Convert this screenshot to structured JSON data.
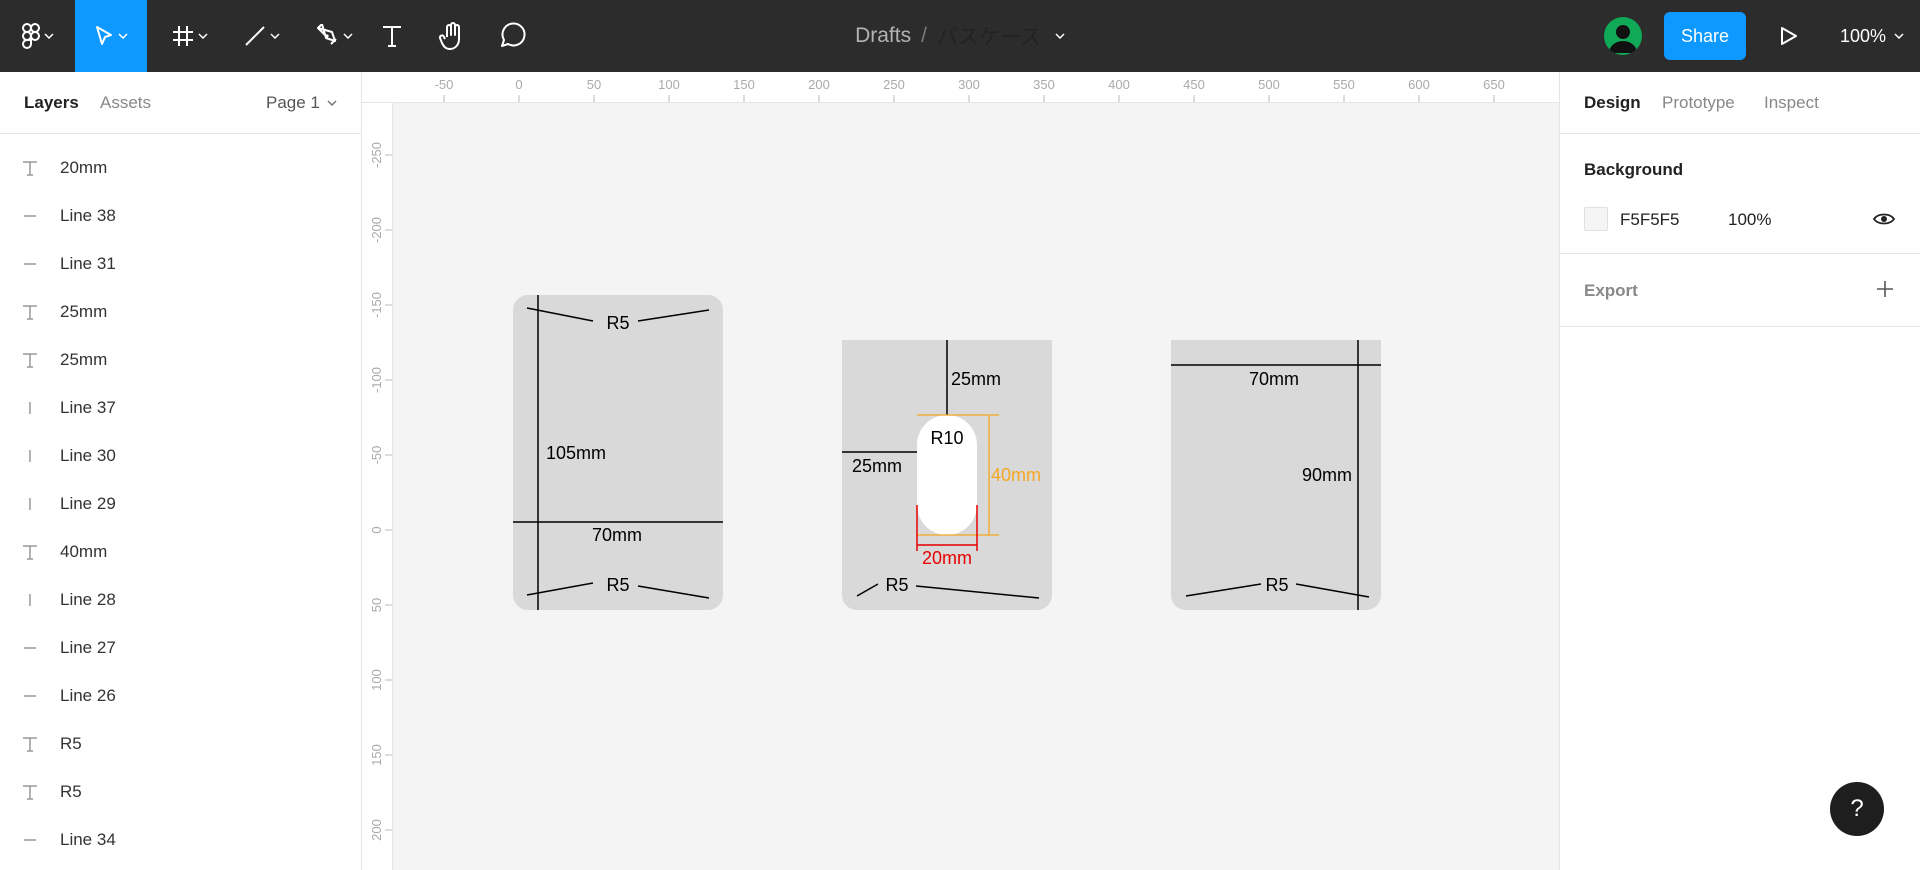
{
  "toolbar": {
    "breadcrumb_drafts": "Drafts",
    "breadcrumb_sep": "/",
    "file_name": "パスケース",
    "share_label": "Share",
    "zoom_label": "100%"
  },
  "left_panel": {
    "tab_layers": "Layers",
    "tab_assets": "Assets",
    "page_selector": "Page 1",
    "layers": [
      {
        "name": "20mm",
        "type": "text"
      },
      {
        "name": "Line 38",
        "type": "hline"
      },
      {
        "name": "Line 31",
        "type": "hline"
      },
      {
        "name": "25mm",
        "type": "text"
      },
      {
        "name": "25mm",
        "type": "text"
      },
      {
        "name": "Line 37",
        "type": "vline"
      },
      {
        "name": "Line 30",
        "type": "vline"
      },
      {
        "name": "Line 29",
        "type": "vline"
      },
      {
        "name": "40mm",
        "type": "text"
      },
      {
        "name": "Line 28",
        "type": "vline"
      },
      {
        "name": "Line 27",
        "type": "hline"
      },
      {
        "name": "Line 26",
        "type": "hline"
      },
      {
        "name": "R5",
        "type": "text"
      },
      {
        "name": "R5",
        "type": "text"
      },
      {
        "name": "Line 34",
        "type": "hline"
      }
    ]
  },
  "rulers": {
    "top": [
      "-50",
      "0",
      "50",
      "100",
      "150",
      "200",
      "250",
      "300",
      "350",
      "400",
      "450",
      "500",
      "550",
      "600",
      "650"
    ],
    "left": [
      "-250",
      "-200",
      "-150",
      "-100",
      "-50",
      "0",
      "50",
      "100",
      "150",
      "200"
    ]
  },
  "canvas": {
    "frame1": {
      "top_radius": "R5",
      "height": "105mm",
      "width": "70mm",
      "bottom_radius": "R5"
    },
    "frame2": {
      "top_dim": "25mm",
      "left_dim": "25mm",
      "hole_radius": "R10",
      "hole_height": "40mm",
      "hole_width": "20mm",
      "bottom_radius": "R5"
    },
    "frame3": {
      "width": "70mm",
      "height": "90mm",
      "bottom_radius": "R5"
    },
    "colors": {
      "frame": "#d9d9d9",
      "hole_height_dim": "#f5a623",
      "hole_width_dim": "#e60000"
    }
  },
  "right_panel": {
    "tab_design": "Design",
    "tab_prototype": "Prototype",
    "tab_inspect": "Inspect",
    "background_title": "Background",
    "bg_hex": "F5F5F5",
    "bg_opacity": "100%",
    "export_title": "Export"
  },
  "help_label": "?"
}
